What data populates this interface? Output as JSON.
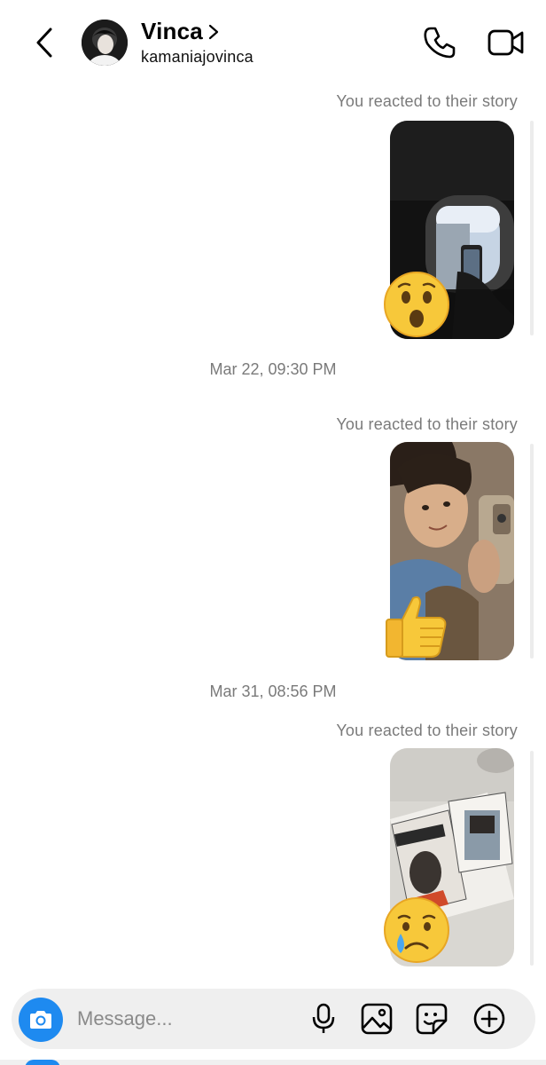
{
  "header": {
    "contact_name": "Vinca",
    "username": "kamaniajovinca",
    "icons": [
      "back-chevron-icon",
      "chevron-right-icon",
      "phone-icon",
      "video-camera-icon"
    ]
  },
  "thread": {
    "messages": [
      {
        "label": "You reacted to their story",
        "reaction": "astonished-face-emoji",
        "story": "airplane-window-selfie"
      },
      {
        "timestamp": "Mar 22, 09:30 PM"
      },
      {
        "label": "You reacted to their story",
        "reaction": "thumbs-up-emoji",
        "story": "mirror-selfie"
      },
      {
        "timestamp": "Mar 31, 08:56 PM"
      },
      {
        "label": "You reacted to their story",
        "reaction": "crying-face-emoji",
        "story": "magazines-on-table"
      }
    ]
  },
  "composer": {
    "placeholder": "Message...",
    "icons": [
      "camera-icon",
      "microphone-icon",
      "gallery-icon",
      "sticker-icon",
      "plus-icon"
    ]
  },
  "colors": {
    "accent": "#1e8af0",
    "secondary_text": "#7a7a7a",
    "composer_bg": "#efefef"
  }
}
